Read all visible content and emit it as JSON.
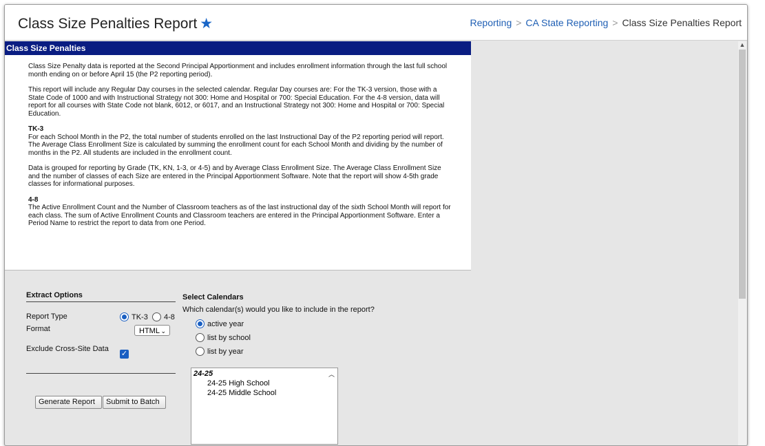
{
  "header": {
    "title": "Class Size Penalties Report",
    "breadcrumb": [
      "Reporting",
      "CA State Reporting",
      "Class Size Penalties Report"
    ]
  },
  "panel": {
    "title": "Class Size Penalties",
    "paragraphs": [
      "Class Size Penalty data is reported at the Second Principal Apportionment and includes enrollment information through the last full school month ending on or before April 15 (the P2 reporting period).",
      "This report will include any Regular Day courses in the selected calendar. Regular Day courses are: For the TK-3 version, those with a State Code of 1000 and with Instructional Strategy not 300: Home and Hospital or 700: Special Education. For the 4-8 version, data will report for all courses with State Code not blank, 6012, or 6017, and an Instructional Strategy not 300: Home and Hospital or 700: Special Education."
    ],
    "tk3_heading": "TK-3",
    "tk3_paragraphs": [
      "For each School Month in the P2, the total number of students enrolled on the last Instructional Day of the P2 reporting period will report. The Average Class Enrollment Size is calculated by summing the enrollment count for each School Month and dividing by the number of months in the P2. All students are included in the enrollment count.",
      "Data is grouped for reporting by Grade (TK, KN, 1-3, or 4-5) and by Average Class Enrollment Size. The Average Class Enrollment Size and the number of classes of each Size are entered in the Principal Apportionment Software. Note that the report will show 4-5th grade classes for informational purposes."
    ],
    "g48_heading": "4-8",
    "g48_paragraph": "The Active Enrollment Count and the Number of Classroom teachers as of the last instructional day of the sixth School Month will report for each class. The sum of Active Enrollment Counts and Classroom teachers are entered in the Principal Apportionment Software. Enter a Period Name to restrict the report to data from one Period."
  },
  "extract": {
    "title": "Extract Options",
    "report_type_label": "Report Type",
    "report_type_options": [
      "TK-3",
      "4-8"
    ],
    "report_type_selected": "TK-3",
    "format_label": "Format",
    "format_value": "HTML",
    "exclude_label": "Exclude Cross-Site Data",
    "exclude_checked": true,
    "generate_label": "Generate Report",
    "batch_label": "Submit to Batch"
  },
  "calendars": {
    "title": "Select Calendars",
    "question": "Which calendar(s) would you like to include in the report?",
    "options": [
      "active year",
      "list by school",
      "list by year"
    ],
    "selected": "active year",
    "list_group": "24-25",
    "list_items": [
      "24-25 High School",
      "24-25 Middle School"
    ]
  },
  "icons": [
    "star-icon",
    "chevron-right-icon",
    "chevron-down-icon",
    "checkmark-icon",
    "scroll-up-icon"
  ],
  "colors": {
    "panel_header": "#0a1d82",
    "link": "#1f5fb4",
    "accent": "#1a5fc2"
  }
}
